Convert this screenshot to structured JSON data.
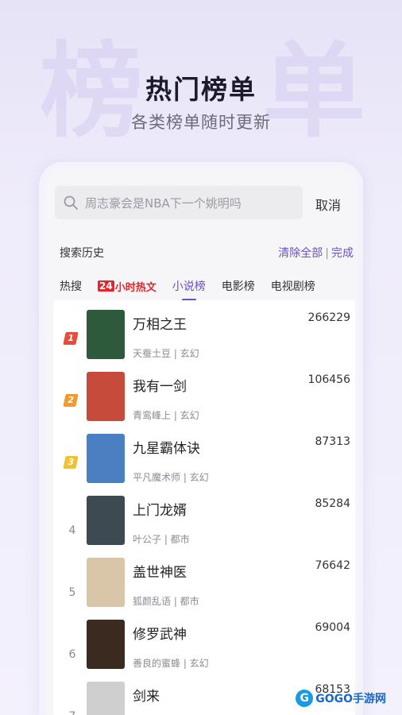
{
  "hero": {
    "title": "热门榜单",
    "subtitle": "各类榜单随时更新"
  },
  "search": {
    "placeholder": "周志豪会是NBA下一个姚明吗",
    "cancel_label": "取消"
  },
  "history": {
    "title": "搜索历史",
    "clear_all_label": "清除全部",
    "done_label": "完成"
  },
  "tabs": [
    {
      "label": "热搜",
      "active": false
    },
    {
      "label": "24小时热文",
      "active": false,
      "badge": "24",
      "rest": "小时热文"
    },
    {
      "label": "小说榜",
      "active": true
    },
    {
      "label": "电影榜",
      "active": false
    },
    {
      "label": "电视剧榜",
      "active": false
    }
  ],
  "accent_color": "#6c4ec9",
  "rank_colors": [
    "#e84a3b",
    "#f29a2e",
    "#f2c12e"
  ],
  "books": [
    {
      "rank": "1",
      "title": "万相之王",
      "author": "天蚕土豆",
      "genre": "玄幻",
      "meta": "天蚕土豆 | 玄幻",
      "count": "266229",
      "cover_color": "#2c5a3a"
    },
    {
      "rank": "2",
      "title": "我有一剑",
      "author": "青鸾峰上",
      "genre": "玄幻",
      "meta": "青鸾峰上 | 玄幻",
      "count": "106456",
      "cover_color": "#c74b3a"
    },
    {
      "rank": "3",
      "title": "九星霸体诀",
      "author": "平凡魔术师",
      "genre": "玄幻",
      "meta": "平凡魔术师 | 玄幻",
      "count": "87313",
      "cover_color": "#4a7fc2"
    },
    {
      "rank": "4",
      "title": "上门龙婿",
      "author": "叶公子",
      "genre": "都市",
      "meta": "叶公子 | 都市",
      "count": "85284",
      "cover_color": "#3e4a52"
    },
    {
      "rank": "5",
      "title": "盖世神医",
      "author": "狐颜乱语",
      "genre": "都市",
      "meta": "狐颜乱语 | 都市",
      "count": "76642",
      "cover_color": "#d9c6a8"
    },
    {
      "rank": "6",
      "title": "修罗武神",
      "author": "善良的蜜蜂",
      "genre": "玄幻",
      "meta": "善良的蜜蜂 | 玄幻",
      "count": "69004",
      "cover_color": "#3b2a20"
    },
    {
      "rank": "7",
      "title": "剑来",
      "author": "",
      "genre": "",
      "meta": "",
      "count": "68153",
      "cover_color": "#cfcfcf"
    }
  ],
  "watermark": {
    "text": "GOGO手游网"
  }
}
